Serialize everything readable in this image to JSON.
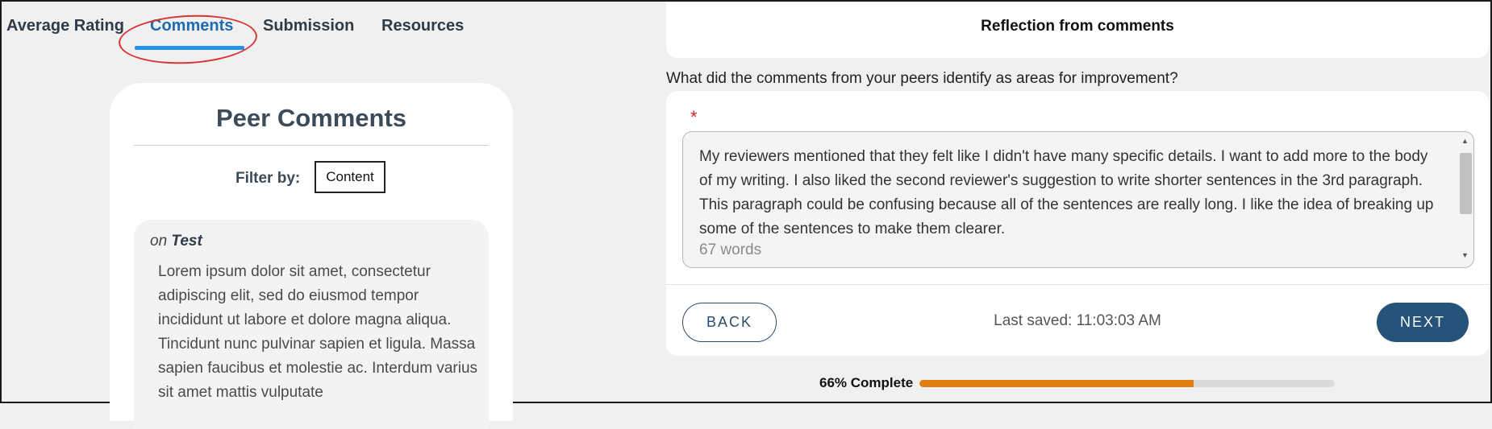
{
  "tabs": {
    "items": [
      {
        "label": "Average Rating"
      },
      {
        "label": "Comments"
      },
      {
        "label": "Submission"
      },
      {
        "label": "Resources"
      }
    ],
    "active": "Comments"
  },
  "peer_comments": {
    "title": "Peer Comments",
    "filter_label": "Filter by:",
    "filter_value": "Content",
    "comment": {
      "on_prefix": "on",
      "on_target": "Test",
      "text": "Lorem ipsum dolor sit amet, consectetur adipiscing elit, sed do eiusmod tempor incididunt ut labore et dolore magna aliqua. Tincidunt nunc pulvinar sapien et ligula. Massa sapien faucibus et molestie ac. Interdum varius sit amet mattis vulputate"
    }
  },
  "reflection": {
    "title": "Reflection from comments",
    "question": "What did the comments from your peers identify as areas for improvement?",
    "required_marker": "*",
    "answer": "My reviewers mentioned that they felt like I didn't have many specific details. I want to add more to the body of my writing. I also liked the second reviewer's suggestion to write shorter sentences in the 3rd paragraph. This paragraph could be confusing because all of the sentences are really long. I like the idea of breaking up some of the sentences to make them clearer.",
    "word_count": "67 words",
    "scroll_up_icon": "▲",
    "scroll_down_icon": "▼"
  },
  "footer": {
    "back_label": "BACK",
    "saved_text": "Last saved: 11:03:03 AM",
    "next_label": "NEXT"
  },
  "progress": {
    "label": "66% Complete",
    "percent": 66,
    "color": "#e07e12"
  }
}
